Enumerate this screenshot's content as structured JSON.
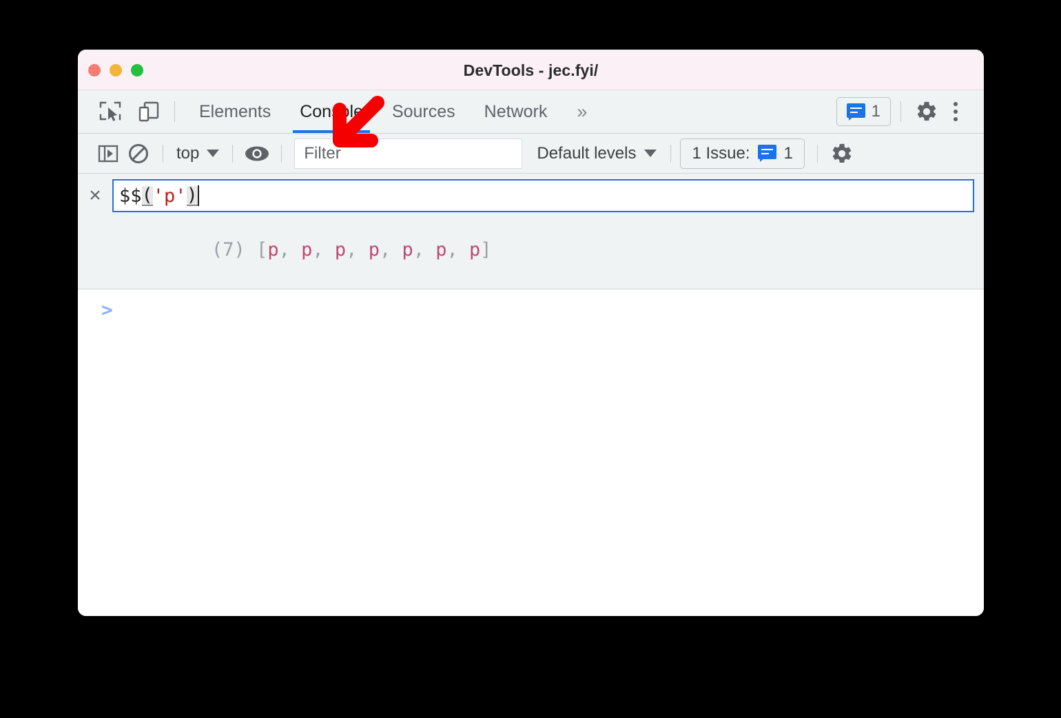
{
  "window": {
    "title": "DevTools - jec.fyi/",
    "traffic_lights": [
      "close",
      "minimize",
      "zoom"
    ]
  },
  "tabbar": {
    "inspect_icon": "inspect-element-icon",
    "device_icon": "device-toolbar-icon",
    "tabs": [
      {
        "label": "Elements",
        "active": false
      },
      {
        "label": "Console",
        "active": true
      },
      {
        "label": "Sources",
        "active": false
      },
      {
        "label": "Network",
        "active": false
      }
    ],
    "more_tabs_label": "»",
    "issues_badge": {
      "icon": "issue-bubble-icon",
      "count": "1"
    },
    "settings_icon": "gear-icon",
    "menu_icon": "kebab-menu-icon"
  },
  "console_toolbar": {
    "sidebar_toggle_icon": "console-sidebar-icon",
    "clear_console_icon": "clear-console-icon",
    "context_selector": {
      "value": "top",
      "caret": "chevron-down-icon"
    },
    "live_expression_icon": "eye-icon",
    "filter": {
      "value": "",
      "placeholder": "Filter"
    },
    "levels": {
      "value": "Default levels",
      "caret": "chevron-down-icon"
    },
    "issues": {
      "label": "1 Issue:",
      "icon": "issue-bubble-icon",
      "count": "1"
    },
    "settings_icon": "gear-icon"
  },
  "console_body": {
    "live_expression": {
      "remove_label": "×",
      "expression_tokens": [
        {
          "text": "$$",
          "type": "fn"
        },
        {
          "text": "(",
          "type": "paren"
        },
        {
          "text": "'p'",
          "type": "string"
        },
        {
          "text": ")",
          "type": "paren"
        }
      ],
      "expression_text": "$$('p')",
      "result_prefix": "(7) ",
      "result_open": "[",
      "result_items": [
        "p",
        "p",
        "p",
        "p",
        "p",
        "p",
        "p"
      ],
      "result_sep": ", ",
      "result_close": "]",
      "result_text": "(7) [p, p, p, p, p, p, p]"
    },
    "prompt_chevron": ">"
  },
  "annotation": {
    "arrow": {
      "color": "#f50000",
      "points_to": "live-expression-eye-icon"
    }
  },
  "colors": {
    "accent_blue": "#1a73e8",
    "toolbar_bg": "#eff3f4",
    "titlebar_bg": "#faf0f5",
    "arrow_red": "#f50000",
    "string_red": "#c41a16",
    "node_pink": "#c0486e",
    "prompt_blue": "#8ab4f8"
  }
}
